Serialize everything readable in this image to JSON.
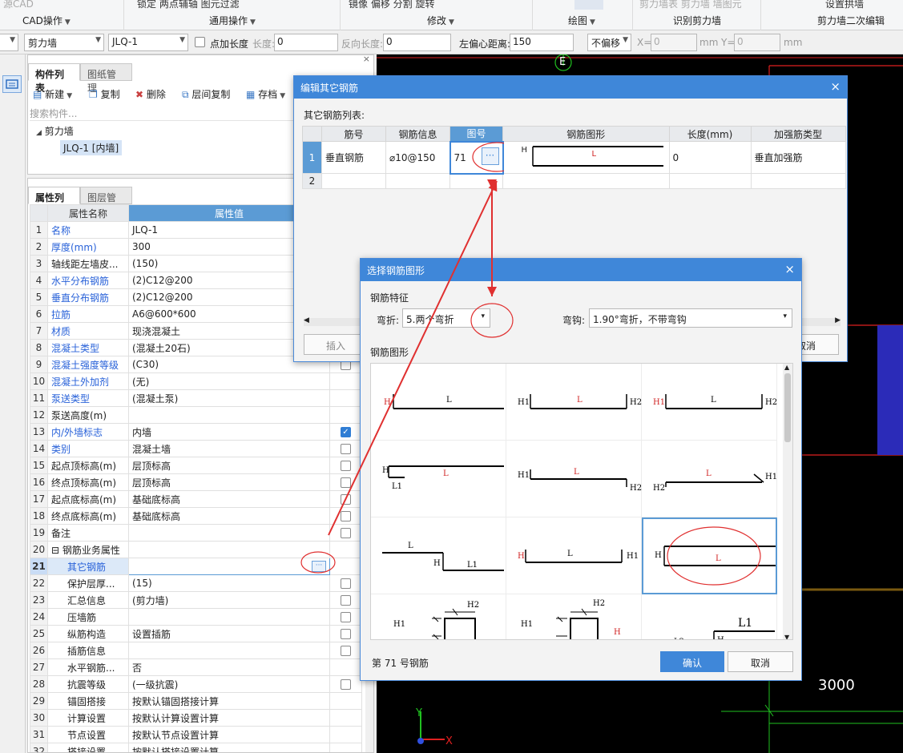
{
  "ribbon": {
    "groups": [
      {
        "label": "CAD操作",
        "top": "源CAD"
      },
      {
        "label": "通用操作",
        "top": "锁定   两点辅轴   图元过滤"
      },
      {
        "label": "修改",
        "top": "镜像   偏移   分割   旋转"
      },
      {
        "label": "绘图",
        "top": ""
      },
      {
        "label": "识别剪力墙",
        "top": "剪力墙表   剪力墙   墙图元"
      },
      {
        "label": "剪力墙二次编辑",
        "top": "设置拱墙"
      }
    ]
  },
  "toolbar": {
    "layer_value": "",
    "type_value": "剪力墙",
    "name_value": "JLQ-1",
    "point_length_label": "点加长度",
    "length_label": "长度:",
    "length_value": "0",
    "reverse_length_label": "反向长度:",
    "reverse_length_value": "0",
    "offset_label": "左偏心距离:",
    "offset_value": "150",
    "offset_mode": "不偏移",
    "x_label": "X=",
    "x_value": "0",
    "y_label": "Y=",
    "y_value": "0",
    "unit1": "mm",
    "unit2": "mm"
  },
  "component_panel": {
    "tabs": [
      "构件列表",
      "图纸管理"
    ],
    "actions": [
      "新建",
      "复制",
      "删除",
      "层间复制",
      "存档"
    ],
    "search_placeholder": "搜索构件...",
    "tree_root": "剪力墙",
    "tree_child": "JLQ-1 [内墙]"
  },
  "property_panel": {
    "tabs": [
      "属性列表",
      "图层管理"
    ],
    "headers": [
      "属性名称",
      "属性值"
    ],
    "rows": [
      {
        "n": "1",
        "name": "名称",
        "value": "JLQ-1",
        "blue": true,
        "chk": ""
      },
      {
        "n": "2",
        "name": "厚度(mm)",
        "value": "300",
        "blue": true,
        "chk": ""
      },
      {
        "n": "3",
        "name": "轴线距左墙皮...",
        "value": "(150)",
        "blue": false,
        "chk": ""
      },
      {
        "n": "4",
        "name": "水平分布钢筋",
        "value": "(2)C12@200",
        "blue": true,
        "chk": ""
      },
      {
        "n": "5",
        "name": "垂直分布钢筋",
        "value": "(2)C12@200",
        "blue": true,
        "chk": ""
      },
      {
        "n": "6",
        "name": "拉筋",
        "value": "A6@600*600",
        "blue": true,
        "chk": ""
      },
      {
        "n": "7",
        "name": "材质",
        "value": "现浇混凝土",
        "blue": true,
        "chk": ""
      },
      {
        "n": "8",
        "name": "混凝土类型",
        "value": "(混凝土20石)",
        "blue": true,
        "chk": ""
      },
      {
        "n": "9",
        "name": "混凝土强度等级",
        "value": "(C30)",
        "blue": true,
        "chk": "off"
      },
      {
        "n": "10",
        "name": "混凝土外加剂",
        "value": "(无)",
        "blue": true,
        "chk": ""
      },
      {
        "n": "11",
        "name": "泵送类型",
        "value": "(混凝土泵)",
        "blue": true,
        "chk": ""
      },
      {
        "n": "12",
        "name": "泵送高度(m)",
        "value": "",
        "blue": false,
        "chk": ""
      },
      {
        "n": "13",
        "name": "内/外墙标志",
        "value": "内墙",
        "blue": true,
        "chk": "on"
      },
      {
        "n": "14",
        "name": "类别",
        "value": "混凝土墙",
        "blue": true,
        "chk": "off"
      },
      {
        "n": "15",
        "name": "起点顶标高(m)",
        "value": "层顶标高",
        "blue": false,
        "chk": "off"
      },
      {
        "n": "16",
        "name": "终点顶标高(m)",
        "value": "层顶标高",
        "blue": false,
        "chk": "off"
      },
      {
        "n": "17",
        "name": "起点底标高(m)",
        "value": "基础底标高",
        "blue": false,
        "chk": "off"
      },
      {
        "n": "18",
        "name": "终点底标高(m)",
        "value": "基础底标高",
        "blue": false,
        "chk": "off"
      },
      {
        "n": "19",
        "name": "备注",
        "value": "",
        "blue": false,
        "chk": "off"
      },
      {
        "n": "20",
        "name": "⊟ 钢筋业务属性",
        "value": "",
        "blue": false,
        "chk": ""
      },
      {
        "n": "21",
        "name": "其它钢筋",
        "value": "",
        "blue": true,
        "chk": "",
        "sel": true
      },
      {
        "n": "22",
        "name": "保护层厚...",
        "value": "(15)",
        "blue": false,
        "chk": "off"
      },
      {
        "n": "23",
        "name": "汇总信息",
        "value": "(剪力墙)",
        "blue": false,
        "chk": "off"
      },
      {
        "n": "24",
        "name": "压墙筋",
        "value": "",
        "blue": false,
        "chk": "off"
      },
      {
        "n": "25",
        "name": "纵筋构造",
        "value": "设置插筋",
        "blue": false,
        "chk": "off"
      },
      {
        "n": "26",
        "name": "插筋信息",
        "value": "",
        "blue": false,
        "chk": "off"
      },
      {
        "n": "27",
        "name": "水平钢筋...",
        "value": "否",
        "blue": false,
        "chk": ""
      },
      {
        "n": "28",
        "name": "抗震等级",
        "value": "(一级抗震)",
        "blue": false,
        "chk": "off"
      },
      {
        "n": "29",
        "name": "锚固搭接",
        "value": "按默认锚固搭接计算",
        "blue": false,
        "chk": ""
      },
      {
        "n": "30",
        "name": "计算设置",
        "value": "按默认计算设置计算",
        "blue": false,
        "chk": ""
      },
      {
        "n": "31",
        "name": "节点设置",
        "value": "按默认节点设置计算",
        "blue": false,
        "chk": ""
      },
      {
        "n": "32",
        "name": "搭接设置",
        "value": "按默认搭接设置计算",
        "blue": false,
        "chk": ""
      }
    ]
  },
  "edit_dialog": {
    "title": "编辑其它钢筋",
    "list_label": "其它钢筋列表:",
    "headers": [
      "筋号",
      "钢筋信息",
      "图号",
      "钢筋图形",
      "长度(mm)",
      "加强筋类型"
    ],
    "row1": {
      "idx": "1",
      "name": "垂直钢筋",
      "info": "⌀10@150",
      "fig": "71",
      "shape_h": "H",
      "shape_l": "L",
      "length": "0",
      "type": "垂直加强筋"
    },
    "row2_idx": "2",
    "insert_label": "插入",
    "cancel_label": "取消"
  },
  "shape_dialog": {
    "title": "选择钢筋图形",
    "feature_label": "钢筋特征",
    "bend_label": "弯折:",
    "bend_value": "5.两个弯折",
    "hook_label": "弯钩:",
    "hook_value": "1.90°弯折，不带弯钩",
    "shapes_label": "钢筋图形",
    "status": "第 71 号钢筋",
    "ok_label": "确认",
    "cancel_label": "取消"
  },
  "cad": {
    "axis_label": "E",
    "dimension": "3000",
    "y_axis": "Y",
    "x_axis": "X"
  }
}
